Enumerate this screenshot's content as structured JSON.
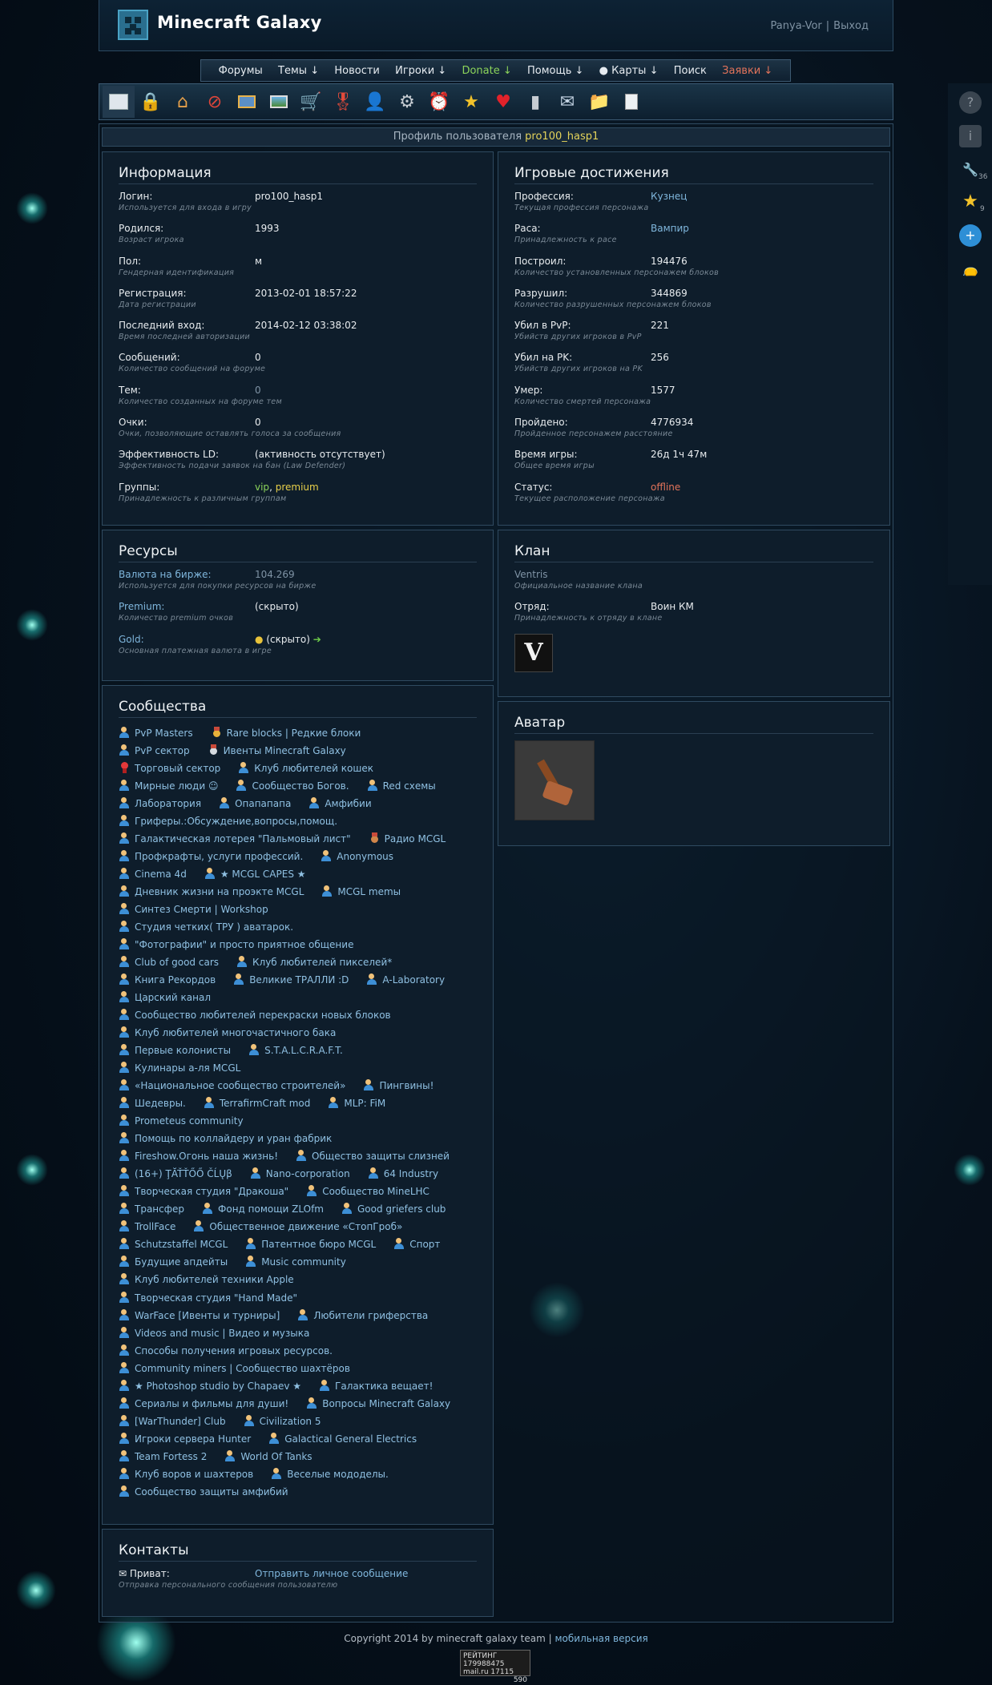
{
  "header": {
    "site_title": "Minecraft Galaxy",
    "username": "Panya-Vor",
    "separator": "|",
    "logout": "Выход"
  },
  "menu": [
    "Форумы",
    "Темы ↓",
    "Новости",
    "Игроки ↓",
    "Donate ↓",
    "Помощь ↓",
    "● Карты ↓",
    "Поиск",
    "Заявки ↓"
  ],
  "toolbar_icons": [
    "profile-card-icon",
    "lock-icon",
    "home-icon",
    "ban-icon",
    "image-icon",
    "picture-icon",
    "cart-icon",
    "award-icon",
    "person-icon",
    "gear-icon",
    "alarm-icon",
    "star-icon",
    "heart-icon",
    "chart-icon",
    "mail-icon",
    "folder-icon",
    "notepad-icon"
  ],
  "profile_bar": {
    "prefix": "Профиль пользователя",
    "username": "pro100_hasp1"
  },
  "info": {
    "title": "Информация",
    "rows": [
      {
        "label": "Логин:",
        "value": "pro100_hasp1",
        "hint": "Используется для входа в игру"
      },
      {
        "label": "Родился:",
        "value": "1993",
        "hint": "Возраст игрока"
      },
      {
        "label": "Пол:",
        "value": "м",
        "hint": "Гендерная идентификация"
      },
      {
        "label": "Регистрация:",
        "value": "2013-02-01 18:57:22",
        "hint": "Дата регистрации"
      },
      {
        "label": "Последний вход:",
        "value": "2014-02-12 03:38:02",
        "hint": "Время последней авторизации"
      },
      {
        "label": "Сообщений:",
        "value": "0",
        "hint": "Количество сообщений на форуме"
      },
      {
        "label": "Тем:",
        "value": "0",
        "hint": "Количество созданных на форуме тем"
      },
      {
        "label": "Очки:",
        "value": "0",
        "hint": "Очки, позволяющие оставлять голоса за сообщения"
      },
      {
        "label": "Эффективность LD:",
        "value": "(активность отсутствует)",
        "hint": "Эффективность подачи заявок на бан (Law Defender)"
      },
      {
        "label": "Группы:",
        "value": "",
        "hint": "Принадлежность к различным группам"
      }
    ],
    "groups": {
      "vip": "vip",
      "comma": ", ",
      "premium": "premium"
    }
  },
  "achievements": {
    "title": "Игровые достижения",
    "rows": [
      {
        "label": "Профессия:",
        "value": "Кузнец",
        "hint": "Текущая профессия персонажа"
      },
      {
        "label": "Раса:",
        "value": "Вампир",
        "hint": "Принадлежность к расе"
      },
      {
        "label": "Построил:",
        "value": "194476",
        "hint": "Количество установленных персонажем блоков"
      },
      {
        "label": "Разрушил:",
        "value": "344869",
        "hint": "Количество разрушенных персонажем блоков"
      },
      {
        "label": "Убил в PvP:",
        "value": "221",
        "hint": "Убийств других игроков в PvP"
      },
      {
        "label": "Убил на PK:",
        "value": "256",
        "hint": "Убийств других игроков на PK"
      },
      {
        "label": "Умер:",
        "value": "1577",
        "hint": "Количество смертей персонажа"
      },
      {
        "label": "Пройдено:",
        "value": "4776934",
        "hint": "Пройденное персонажем расстояние"
      },
      {
        "label": "Время игры:",
        "value": "26д 1ч 47м",
        "hint": "Общее время игры"
      },
      {
        "label": "Статус:",
        "value": "offline",
        "hint": "Текущее расположение персонажа"
      }
    ]
  },
  "resources": {
    "title": "Ресурсы",
    "rows": [
      {
        "label": "Валюта на бирже:",
        "value": "104.269",
        "hint": "Используется для покупки ресурсов на бирже"
      },
      {
        "label": "Premium:",
        "value": "(скрыто)",
        "hint": "Количество premium очков"
      },
      {
        "label": "Gold:",
        "value": "(скрыто)",
        "hint": "Основная платежная валюта в игре"
      }
    ]
  },
  "clan": {
    "title": "Клан",
    "name": "Ventris",
    "name_hint": "Официальное название клана",
    "squad_label": "Отряд:",
    "squad_value": "Воин КМ",
    "squad_hint": "Принадлежность к отряду в клане",
    "emblem_letter": "V"
  },
  "avatar": {
    "title": "Аватар"
  },
  "communities": {
    "title": "Сообщества",
    "rows": [
      [
        [
          "user",
          "PvP Masters"
        ],
        [
          "medal-gold",
          "Rare blocks | Редкие блоки"
        ]
      ],
      [
        [
          "user",
          "PvP сектор"
        ],
        [
          "medal-silver",
          "Ивенты Minecraft Galaxy"
        ]
      ],
      [
        [
          "ribbon",
          "Торговый сектор"
        ],
        [
          "user",
          "Клуб любителей кошек"
        ]
      ],
      [
        [
          "user",
          "Мирные люди ☺"
        ],
        [
          "user",
          "Сообщество Богов."
        ],
        [
          "user",
          "Red схемы"
        ]
      ],
      [
        [
          "user",
          "Лаборатория"
        ],
        [
          "user",
          "Опапапапа"
        ],
        [
          "user",
          "Амфибии"
        ]
      ],
      [
        [
          "user",
          "Гриферы.:Обсуждение,вопросы,помощ."
        ]
      ],
      [
        [
          "user",
          "Галактическая лотерея \"Пальмовый лист\""
        ],
        [
          "medal-bronze",
          "Радио MCGL"
        ]
      ],
      [
        [
          "user",
          "Профкрафты, услуги профессий."
        ],
        [
          "user",
          "Anonymous"
        ]
      ],
      [
        [
          "user",
          "Cinema 4d"
        ],
        [
          "user",
          "★ MCGL CAPES ★"
        ]
      ],
      [
        [
          "user",
          "Дневник жизни на проэкте MCGL"
        ],
        [
          "user",
          "MCGL memы"
        ]
      ],
      [
        [
          "user",
          "Синтез Смерти | Workshop"
        ]
      ],
      [
        [
          "user",
          "Студия четких( ТРУ ) аватарок."
        ]
      ],
      [
        [
          "user",
          "\"Фотографии\" и просто приятное общение"
        ]
      ],
      [
        [
          "user",
          "Club of good cars"
        ],
        [
          "user",
          "Клуб любителей пикселей*"
        ]
      ],
      [
        [
          "user",
          "Книга Рекордов"
        ],
        [
          "user",
          "Великие ТРАЛЛИ :D"
        ],
        [
          "user",
          "A-Laboratory"
        ]
      ],
      [
        [
          "user",
          "Царский канал"
        ]
      ],
      [
        [
          "user",
          "Сообщество любителей перекраски новых блоков"
        ]
      ],
      [
        [
          "user",
          "Клуб любителей многочастичного бака"
        ]
      ],
      [
        [
          "user",
          "Первые колонисты"
        ],
        [
          "user",
          "S.T.A.L.C.R.A.F.T."
        ]
      ],
      [
        [
          "user",
          "Кулинары а-ля MCGL"
        ]
      ],
      [
        [
          "user",
          "«Национальное сообщество строителей»"
        ],
        [
          "user",
          "Пингвины!"
        ]
      ],
      [
        [
          "user",
          "Шедевры."
        ],
        [
          "user",
          "TerrafirmCraft mod"
        ],
        [
          "user",
          "MLP: FiM"
        ]
      ],
      [
        [
          "user",
          "Prometeus community"
        ]
      ],
      [
        [
          "user",
          "Помощь по коллайдеру и уран фабрик"
        ]
      ],
      [
        [
          "user",
          "Fireshow.Огонь наша жизнь!"
        ],
        [
          "user",
          "Общество защиты слизней"
        ]
      ],
      [
        [
          "user",
          "(16+) ŢĂŤŤŐŐ ČĹŲβ"
        ],
        [
          "user",
          "Nano-corporation"
        ],
        [
          "user",
          "64 Industry"
        ]
      ],
      [
        [
          "user",
          "Творческая студия \"Дракоша\""
        ],
        [
          "user",
          "Сообщество MineLHC"
        ]
      ],
      [
        [
          "user",
          "Трансфер"
        ],
        [
          "user",
          "Фонд помощи ZLOfm"
        ],
        [
          "user",
          "Good griefers club"
        ]
      ],
      [
        [
          "user",
          "TrollFace"
        ],
        [
          "user",
          "Общественное движение «СтопГроб»"
        ]
      ],
      [
        [
          "user",
          "Schutzstaffel MCGL"
        ],
        [
          "user",
          "Патентное бюро MCGL"
        ],
        [
          "user",
          "Спорт"
        ]
      ],
      [
        [
          "user",
          "Будущие апдейты"
        ],
        [
          "user",
          "Music community"
        ]
      ],
      [
        [
          "user",
          "Клуб любителей техники Apple"
        ]
      ],
      [
        [
          "user",
          "Творческая студия \"Hand Made\""
        ]
      ],
      [
        [
          "user",
          "WarFace [Ивенты и турниры]"
        ],
        [
          "user",
          "Любители гриферства"
        ]
      ],
      [
        [
          "user",
          "Videos and music | Видео и музыка"
        ]
      ],
      [
        [
          "user",
          "Способы получения игровых ресурсов."
        ]
      ],
      [
        [
          "user",
          "Community miners | Сообщество шахтёров"
        ]
      ],
      [
        [
          "user",
          "★ Photoshop studio by Chapaev ★"
        ],
        [
          "user",
          "Галактика вещает!"
        ]
      ],
      [
        [
          "user",
          "Сериалы и фильмы для души!"
        ],
        [
          "user",
          "Вопросы Minecraft Galaxy"
        ]
      ],
      [
        [
          "user",
          "[WarThunder] Club"
        ],
        [
          "user",
          "Civilization 5"
        ]
      ],
      [
        [
          "user",
          "Игроки сервера Hunter"
        ],
        [
          "user",
          "Galactical General Electrics"
        ]
      ],
      [
        [
          "user",
          "Team Fortess 2"
        ],
        [
          "user",
          "World Of Tanks"
        ]
      ],
      [
        [
          "user",
          "Клуб воров и шахтеров"
        ],
        [
          "user",
          "Веселые мододелы."
        ]
      ],
      [
        [
          "user",
          "Сообщество защиты амфибий"
        ]
      ]
    ]
  },
  "contacts": {
    "title": "Контакты",
    "label": "✉ Приват:",
    "link": "Отправить личное сообщение",
    "hint": "Отправка персонального сообщения пользователю"
  },
  "rightbar": {
    "tools_count": "36",
    "star_count": "9"
  },
  "footer": {
    "copyright": "Copyright 2014 by minecraft galaxy team",
    "sep": " | ",
    "mobile": "мобильная версия"
  },
  "counter": {
    "line1": "РЕЙТИНГ 179988475",
    "line2": "mail.ru 17115",
    "line3": "590"
  },
  "colors": {
    "accent": "#7fb6dc",
    "highlight": "#e8d04a",
    "offline": "#e2735a",
    "donate": "#8bd35a",
    "requests": "#e2735a"
  }
}
